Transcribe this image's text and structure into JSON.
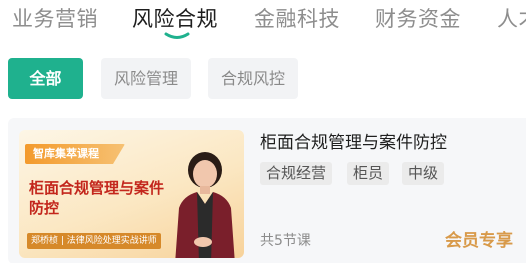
{
  "tabs": [
    "业务营销",
    "风险合规",
    "金融科技",
    "财务资金",
    "人才"
  ],
  "active_tab": "风险合规",
  "filters": [
    "全部",
    "风险管理",
    "合规风控"
  ],
  "active_filter": "全部",
  "colors": {
    "accent": "#1fb18e",
    "member": "#d89a4a",
    "thumb_title": "#c3261c"
  },
  "course": {
    "thumbnail": {
      "badge": "智库集萃课程",
      "title": "柜面合规管理与案件防控",
      "author": "郑桥桢 | 法律风险处理实战讲师"
    },
    "title": "柜面合规管理与案件防控",
    "tags": [
      "合规经营",
      "柜员",
      "中级"
    ],
    "lessons": "共5节课",
    "member_label": "会员专享"
  }
}
